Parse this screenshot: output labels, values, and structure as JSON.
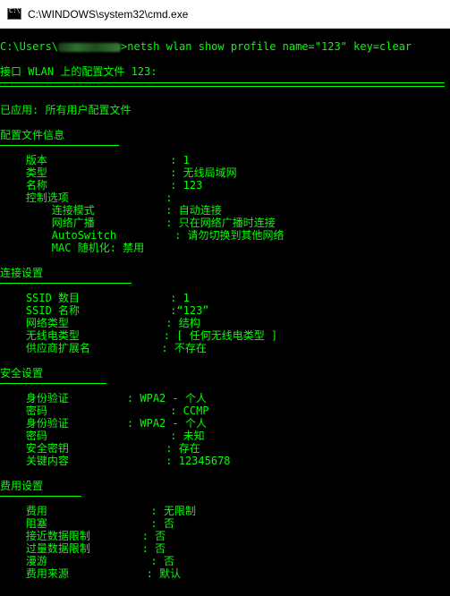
{
  "window": {
    "title": "C:\\WINDOWS\\system32\\cmd.exe",
    "icon": "cmd-icon",
    "text_color": "#00ff00",
    "background": "#000000"
  },
  "console": {
    "prompt_prefix": "C:\\Users\\",
    "command": ">netsh wlan show profile name=\"123\" key=clear",
    "lines": [
      "接口 WLAN 上的配置文件 123:",
      "已应用: 所有用户配置文件",
      "配置文件信息",
      "    版本                   : 1",
      "    类型                   : 无线局域网",
      "    名称                   : 123",
      "    控制选项               :",
      "        连接模式           : 自动连接",
      "        网络广播           : 只在网络广播时连接",
      "        AutoSwitch         : 请勿切换到其他网络",
      "        MAC 随机化: 禁用",
      "连接设置",
      "    SSID 数目              : 1",
      "    SSID 名称              :“123”",
      "    网络类型               : 结构",
      "    无线电类型             : [ 任何无线电类型 ]",
      "    供应商扩展名           : 不存在",
      "安全设置",
      "    身份验证         : WPA2 - 个人",
      "    密码                   : CCMP",
      "    身份验证         : WPA2 - 个人",
      "    密码                   : 未知",
      "    安全密钥               : 存在",
      "    关键内容               : 12345678",
      "费用设置",
      "    费用                : 无限制",
      "    阻塞                : 否",
      "    接近数据限制        : 否",
      "    过量数据限制        : 否",
      "    漫游                : 否",
      "    费用来源            : 默认"
    ]
  }
}
